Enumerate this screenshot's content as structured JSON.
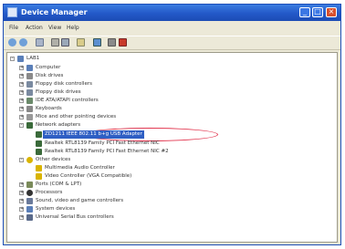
{
  "window": {
    "title": "Device Manager"
  },
  "menu": [
    "File",
    "Action",
    "View",
    "Help"
  ],
  "toolbar": [
    "back-icon",
    "forward-icon",
    "properties-icon",
    "print-icon",
    "help-icon",
    "scan-icon",
    "uninstall-icon",
    "disable-icon",
    "update-icon"
  ],
  "tree": [
    {
      "label": "LAB1",
      "level": 0,
      "expander": "-",
      "icon": "computer-icon",
      "color": "#5a7fb8"
    },
    {
      "label": "Computer",
      "level": 1,
      "expander": "+",
      "icon": "computer-icon",
      "color": "#5a7fb8"
    },
    {
      "label": "Disk drives",
      "level": 1,
      "expander": "+",
      "icon": "disk-icon",
      "color": "#8a8a8a"
    },
    {
      "label": "Floppy disk controllers",
      "level": 1,
      "expander": "+",
      "icon": "floppy-icon",
      "color": "#7a8aa0"
    },
    {
      "label": "Floppy disk drives",
      "level": 1,
      "expander": "+",
      "icon": "floppy-icon",
      "color": "#7a8aa0"
    },
    {
      "label": "IDE ATA/ATAPI controllers",
      "level": 1,
      "expander": "+",
      "icon": "ide-icon",
      "color": "#6a8a6a"
    },
    {
      "label": "Keyboards",
      "level": 1,
      "expander": "+",
      "icon": "keyboard-icon",
      "color": "#888"
    },
    {
      "label": "Mice and other pointing devices",
      "level": 1,
      "expander": "+",
      "icon": "mouse-icon",
      "color": "#999"
    },
    {
      "label": "Network adapters",
      "level": 1,
      "expander": "-",
      "icon": "network-icon",
      "color": "#3a6a3a"
    },
    {
      "label": "ZD1211 IEEE 802.11 b+g USB Adapter",
      "level": 2,
      "expander": "",
      "icon": "network-icon",
      "color": "#3a6a3a",
      "selected": true
    },
    {
      "label": "Realtek RTL8139 Family PCI Fast Ethernet NIC",
      "level": 2,
      "expander": "",
      "icon": "network-icon",
      "color": "#3a6a3a"
    },
    {
      "label": "Realtek RTL8139 Family PCI Fast Ethernet NIC #2",
      "level": 2,
      "expander": "",
      "icon": "network-icon",
      "color": "#3a6a3a"
    },
    {
      "label": "Other devices",
      "level": 1,
      "expander": "-",
      "icon": "question-icon",
      "color": "#d9b400"
    },
    {
      "label": "Multimedia Audio Controller",
      "level": 2,
      "expander": "",
      "icon": "warning-icon",
      "color": "#d9b400"
    },
    {
      "label": "Video Controller (VGA Compatible)",
      "level": 2,
      "expander": "",
      "icon": "warning-icon",
      "color": "#d9b400"
    },
    {
      "label": "Ports (COM & LPT)",
      "level": 1,
      "expander": "+",
      "icon": "port-icon",
      "color": "#7a8a5a"
    },
    {
      "label": "Processors",
      "level": 1,
      "expander": "+",
      "icon": "processor-icon",
      "color": "#333"
    },
    {
      "label": "Sound, video and game controllers",
      "level": 1,
      "expander": "+",
      "icon": "sound-icon",
      "color": "#6a7a9a"
    },
    {
      "label": "System devices",
      "level": 1,
      "expander": "+",
      "icon": "system-icon",
      "color": "#5a7fb8"
    },
    {
      "label": "Universal Serial Bus controllers",
      "level": 1,
      "expander": "+",
      "icon": "usb-icon",
      "color": "#5a6a8a"
    }
  ]
}
